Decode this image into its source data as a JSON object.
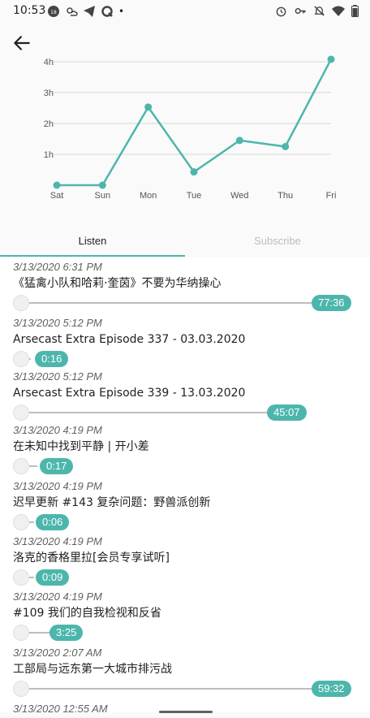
{
  "status_bar": {
    "time": "10:53",
    "left_icons": [
      "notification-icon",
      "weather-icon",
      "telegram-icon",
      "q-app-icon"
    ],
    "dot": "•",
    "right_icons": [
      "alarm-icon",
      "vpn-key-icon",
      "mute-icon",
      "wifi-icon",
      "battery-icon"
    ]
  },
  "chart_data": {
    "type": "line",
    "categories": [
      "Sat",
      "Sun",
      "Mon",
      "Tue",
      "Wed",
      "Thu",
      "Fri"
    ],
    "values": [
      0.0,
      0.0,
      2.53,
      0.43,
      1.45,
      1.25,
      4.08
    ],
    "y_ticks": [
      "1h",
      "2h",
      "3h",
      "4h"
    ],
    "ylim": [
      0,
      4.3
    ],
    "grid": true,
    "line_color": "#4db6ac"
  },
  "tabs": [
    {
      "label": "Listen",
      "active": true
    },
    {
      "label": "Subscribe",
      "active": false
    }
  ],
  "episodes": [
    {
      "timestamp": "3/13/2020 6:31 PM",
      "title": "《猛禽小队和哈莉·奎茵》不要为华纳操心",
      "duration": "77:36",
      "progress": 1.0
    },
    {
      "timestamp": "3/13/2020 5:12 PM",
      "title": "Arsecast Extra Episode 337 - 03.03.2020",
      "duration": "0:16",
      "progress": 0.0
    },
    {
      "timestamp": "3/13/2020 5:12 PM",
      "title": "Arsecast Extra Episode 339 - 13.03.2020",
      "duration": "45:07",
      "progress": 0.6
    },
    {
      "timestamp": "3/13/2020 4:19 PM",
      "title": "在未知中找到平静 | 开小差",
      "duration": "0:17",
      "progress": 0.02
    },
    {
      "timestamp": "3/13/2020 4:19 PM",
      "title": "迟早更新 #143 复杂问题：野兽派创新",
      "duration": "0:06",
      "progress": 0.01
    },
    {
      "timestamp": "3/13/2020 4:19 PM",
      "title": "洛克的香格里拉[会员专享试听]",
      "duration": "0:09",
      "progress": 0.01
    },
    {
      "timestamp": "3/13/2020 4:19 PM",
      "title": "#109 我们的自我检视和反省",
      "duration": "3:25",
      "progress": 0.05
    },
    {
      "timestamp": "3/13/2020 2:07 AM",
      "title": "工部局与远东第一大城市排污战",
      "duration": "59:32",
      "progress": 1.0
    }
  ],
  "partial_timestamp": "3/13/2020 12:55 AM",
  "accent_color": "#4db6ac"
}
